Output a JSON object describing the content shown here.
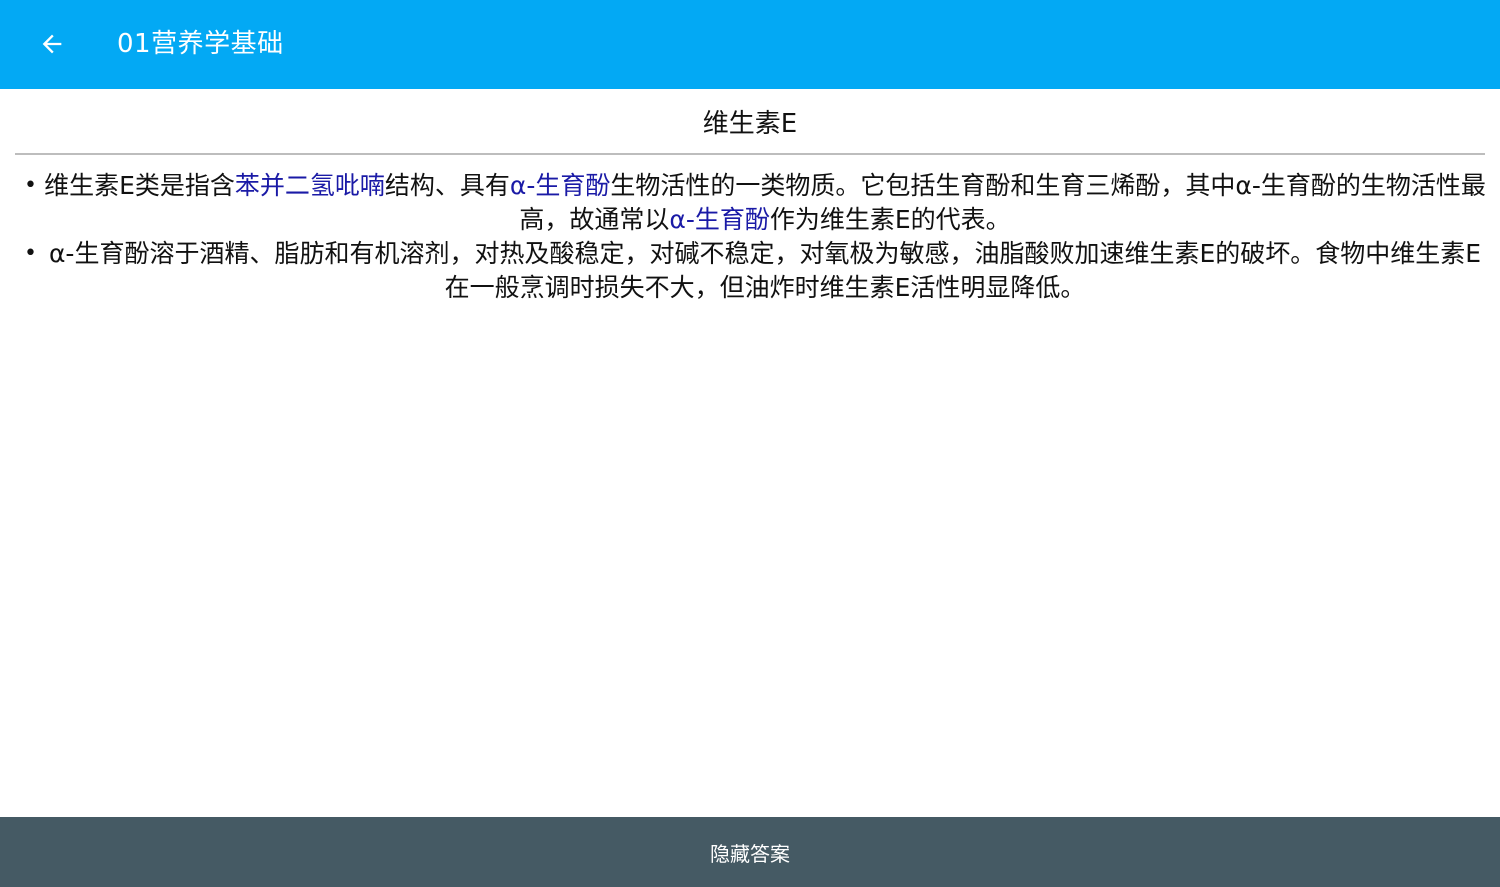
{
  "app_bar": {
    "title": "01营养学基础",
    "back_icon": "arrow-left-icon",
    "background": "#03a9f4"
  },
  "content": {
    "title": "维生素E",
    "items": [
      {
        "segments": [
          {
            "text": "维生素E类是指含",
            "link": false
          },
          {
            "text": "苯并二氢吡喃",
            "link": true
          },
          {
            "text": "结构、具有",
            "link": false
          },
          {
            "text": "α-生育酚",
            "link": true
          },
          {
            "text": "生物活性的一类物质。它包括生育酚和生育三烯酚，其中α-生育酚的生物活性最高，故通常以",
            "link": false
          },
          {
            "text": "α-生育酚",
            "link": true
          },
          {
            "text": "作为维生素E的代表。",
            "link": false
          }
        ]
      },
      {
        "segments": [
          {
            "text": "α-生育酚溶于酒精、脂肪和有机溶剂，对热及酸稳定，对碱不稳定，对氧极为敏感，油脂酸败加速维生素E的破坏。食物中维生素E在一般烹调时损失不大，但油炸时维生素E活性明显降低。",
            "link": false
          }
        ]
      }
    ],
    "link_color": "#1a1aa6"
  },
  "bottom_bar": {
    "label": "隐藏答案",
    "background": "#455a64"
  }
}
